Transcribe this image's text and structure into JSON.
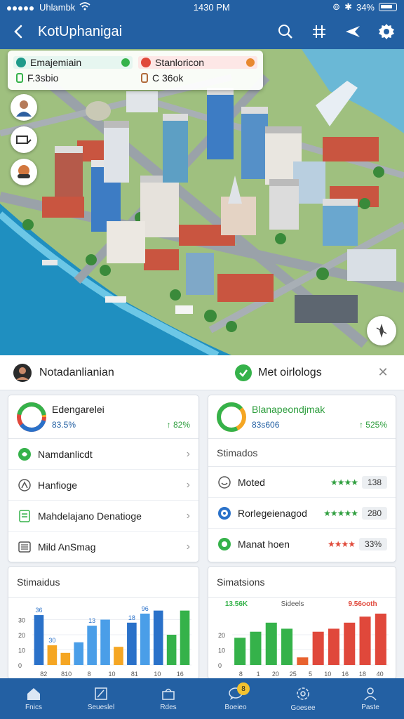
{
  "status_bar": {
    "carrier": "Uhlambk",
    "time": "1430 PM",
    "battery": "34%"
  },
  "header": {
    "title": "KotUphanigai"
  },
  "map_overlay": {
    "item1_label": "Emajemiain",
    "item1_value": "F.3sbio",
    "item2_label": "Stanloricon",
    "item2_value": "C 36ok"
  },
  "info_bar": {
    "user_name": "Notadanlianian",
    "stat_label": "Met oirlologs"
  },
  "left_card": {
    "title": "Edengarelei",
    "value": "83.5%",
    "percent": "↑ 82%",
    "rows": [
      {
        "label": "Namdanlicdt",
        "icon": "leaf-icon"
      },
      {
        "label": "Hanfioge",
        "icon": "compass-icon"
      },
      {
        "label": "Mahdelajano Denatioge",
        "icon": "document-icon"
      },
      {
        "label": "Mild AnSmag",
        "icon": "list-icon"
      }
    ]
  },
  "right_card": {
    "title": "Blanapeondjmak",
    "value": "83s606",
    "percent": "↑ 525%",
    "sub_header": "Stimados",
    "rows": [
      {
        "label": "Moted",
        "badge": "138",
        "stars": "★★★★",
        "star_color": "green",
        "icon": "smile-icon"
      },
      {
        "label": "Rorlegeienagod",
        "badge": "280",
        "stars": "★★★★★",
        "star_color": "green",
        "icon": "target-icon"
      },
      {
        "label": "Manat hoen",
        "badge": "33%",
        "stars": "★★★★",
        "star_color": "red",
        "icon": "flower-icon"
      }
    ]
  },
  "chart_left_title": "Stimaidus",
  "chart_right_title": "Simatsions",
  "chart_data": [
    {
      "type": "bar",
      "title": "Stimaidus",
      "ylim": [
        0,
        40
      ],
      "yticks": [
        "0",
        "10",
        "20",
        "30"
      ],
      "xlabels": [
        "82",
        "810",
        "8",
        "10",
        "81",
        "10",
        "16"
      ],
      "bar_labels": [
        "36",
        "30",
        "13",
        "18",
        "96"
      ],
      "series": [
        {
          "color": "#2a71c9",
          "values": [
            33,
            12,
            28,
            34
          ]
        },
        {
          "color": "#f5a623",
          "values": [
            13,
            8,
            9
          ]
        },
        {
          "color": "#4a9ee8",
          "values": [
            15,
            26,
            36
          ]
        },
        {
          "color": "#35b24a",
          "values": [
            20,
            36
          ]
        }
      ],
      "values": [
        33,
        13,
        8,
        15,
        26,
        30,
        12,
        28,
        34,
        36,
        20,
        36
      ]
    },
    {
      "type": "bar",
      "title": "Simatsions",
      "ylim": [
        0,
        40
      ],
      "yticks": [
        "0",
        "10",
        "20"
      ],
      "xlabels": [
        "8",
        "1",
        "20",
        "25",
        "5",
        "10",
        "16",
        "18",
        "40"
      ],
      "annotations": [
        "13.56K",
        "Sideels",
        "9.56ooth"
      ],
      "series": [
        {
          "name": "green",
          "color": "#35b24a",
          "values": [
            18,
            22,
            28,
            24
          ]
        },
        {
          "name": "orange",
          "color": "#e8622f",
          "values": [
            5
          ]
        },
        {
          "name": "red",
          "color": "#e0483b",
          "values": [
            22,
            24,
            28,
            32,
            34
          ]
        }
      ],
      "values": [
        18,
        22,
        28,
        24,
        5,
        22,
        24,
        28,
        32,
        34
      ]
    }
  ],
  "bottom_nav": [
    {
      "label": "Fnics",
      "icon": "home-icon"
    },
    {
      "label": "Seueslel",
      "icon": "edit-icon"
    },
    {
      "label": "Rdes",
      "icon": "bag-icon"
    },
    {
      "label": "Boeieo",
      "icon": "chat-icon",
      "badge": "8"
    },
    {
      "label": "Goesee",
      "icon": "gear-icon"
    },
    {
      "label": "Paste",
      "icon": "user-icon"
    }
  ],
  "colors": {
    "primary": "#2360a3",
    "green": "#35b24a",
    "red": "#e0483b",
    "orange": "#f5a623"
  }
}
